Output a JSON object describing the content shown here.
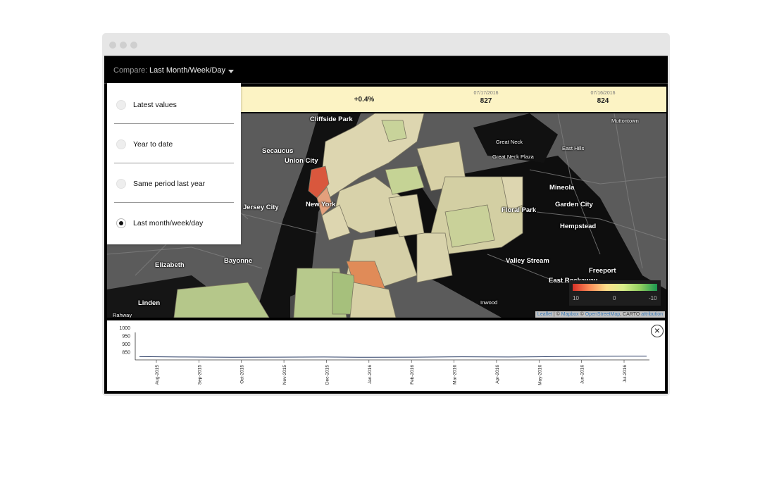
{
  "compare": {
    "label": "Compare:",
    "value": "Last Month/Week/Day"
  },
  "dropdown": {
    "options": [
      {
        "label": "Latest values",
        "selected": false
      },
      {
        "label": "Year to date",
        "selected": false
      },
      {
        "label": "Same period last year",
        "selected": false
      },
      {
        "label": "Last month/week/day",
        "selected": true
      }
    ]
  },
  "stats": {
    "change": "+0.4%",
    "current": {
      "date": "07/17/2016",
      "value": "827"
    },
    "previous": {
      "date": "07/16/2016",
      "value": "824"
    }
  },
  "map": {
    "places": [
      "Cliffside Park",
      "Secaucus",
      "Union City",
      "Jersey City",
      "New York",
      "Bayonne",
      "Elizabeth",
      "Linden",
      "Rahway",
      "Great Neck",
      "Great Neck Plaza",
      "East Hills",
      "Muttontown",
      "Mineola",
      "Floral Park",
      "Garden City",
      "Hempstead",
      "Valley Stream",
      "East Rockaway",
      "Freeport",
      "Inwood"
    ],
    "legend": {
      "left": "10",
      "mid": "0",
      "right": "-10"
    },
    "attribution": {
      "leaflet": "Leaflet",
      "sep1": " | © ",
      "mapbox": "Mapbox",
      "sep2": " © ",
      "osm": "OpenStreetMap",
      "carto": ", CARTO ",
      "attr": "attribution"
    }
  },
  "colors": {
    "worse": "#d73027",
    "neutral": "#fee08b",
    "better": "#1a9850"
  },
  "chart_data": {
    "type": "line",
    "x": [
      "Aug-2015",
      "Sep-2015",
      "Oct-2015",
      "Nov-2015",
      "Dec-2015",
      "Jan-2016",
      "Feb-2016",
      "Mar-2016",
      "Apr-2016",
      "May-2016",
      "Jun-2016",
      "Jul-2016"
    ],
    "y_ticks": [
      "1000",
      "950",
      "900",
      "850"
    ],
    "ylim": [
      800,
      1000
    ],
    "series": [
      {
        "values": [
          820,
          818,
          816,
          817,
          818,
          816,
          817,
          819,
          818,
          820,
          822,
          823
        ]
      }
    ],
    "grid": false
  }
}
